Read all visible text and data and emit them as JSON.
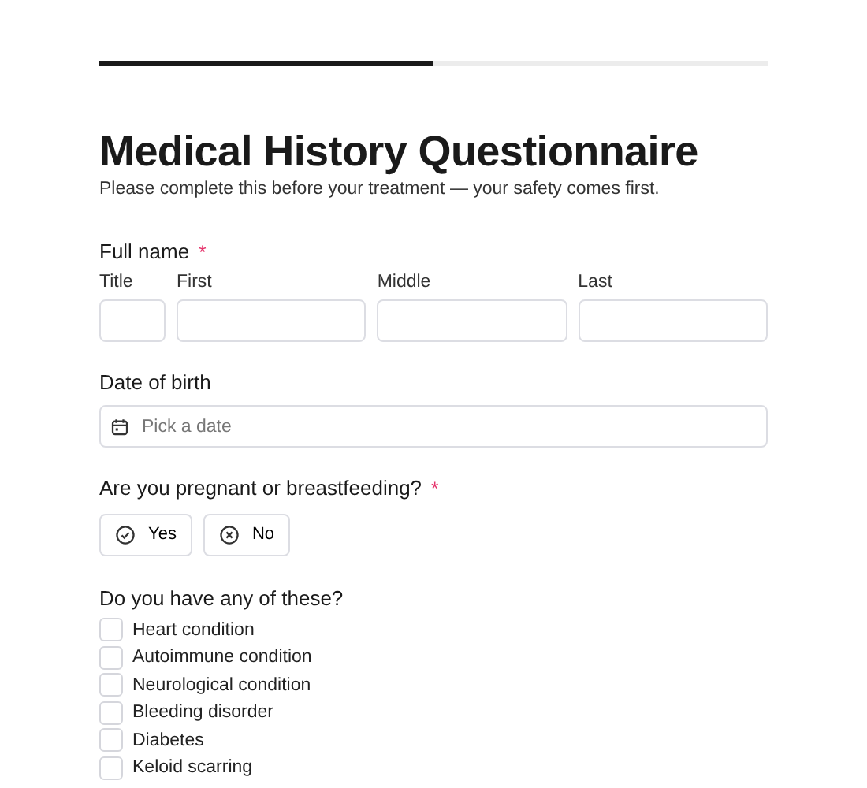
{
  "progress": {
    "level": 0.5
  },
  "title": "Medical History Questionnaire",
  "subtitle": "Please complete this before your treatment — your safety comes first.",
  "full_name": {
    "label": "Full name",
    "marker": "*",
    "fields": [
      {
        "label": "Title"
      },
      {
        "label": "First"
      },
      {
        "label": "Middle"
      },
      {
        "label": "Last"
      }
    ]
  },
  "date_of_birth": {
    "label": "Date of birth",
    "placeholder": "Pick a date"
  },
  "pregnant": {
    "label": "Are you pregnant or breastfeeding?",
    "marker": "*",
    "options": [
      {
        "kind": "yes",
        "label": "Yes",
        "selected": false
      },
      {
        "kind": "no",
        "label": "No",
        "selected": false
      }
    ]
  },
  "conditions": {
    "label": "Do you have any of these?",
    "items": [
      {
        "label": "Heart condition",
        "checked": false
      },
      {
        "label": "Autoimmune condition",
        "checked": false
      },
      {
        "label": "Neurological condition",
        "checked": false
      },
      {
        "label": "Bleeding disorder",
        "checked": false
      },
      {
        "label": "Diabetes",
        "checked": false
      },
      {
        "label": "Keloid scarring",
        "checked": false
      }
    ]
  }
}
